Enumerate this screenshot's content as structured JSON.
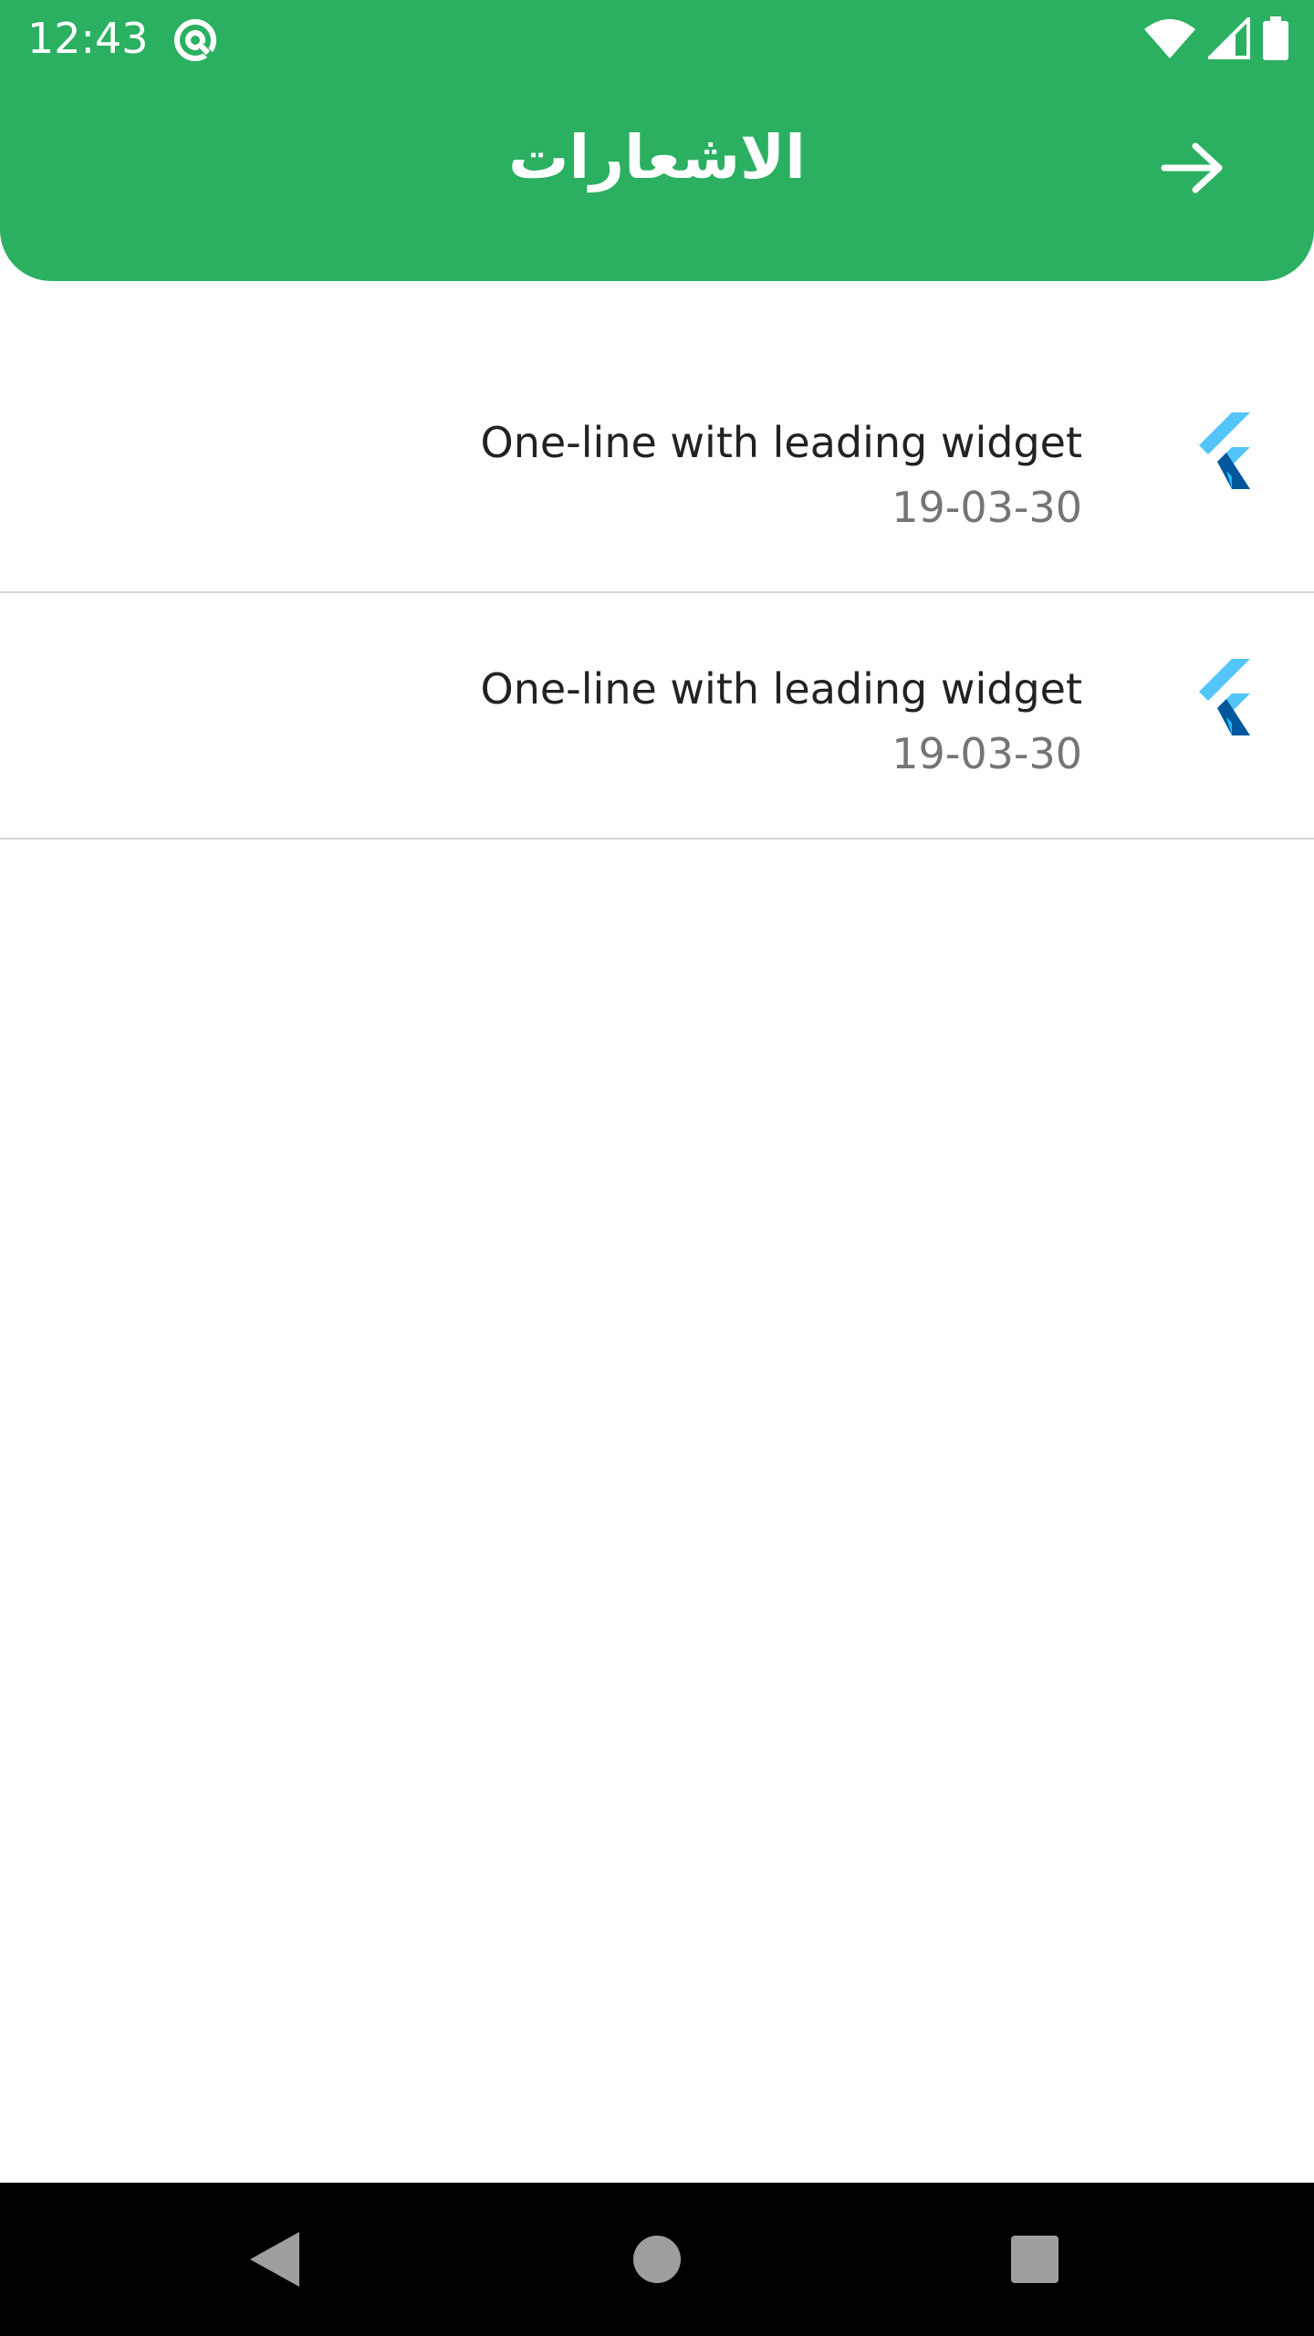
{
  "status_bar": {
    "time": "12:43",
    "icons": [
      "at-sign-icon",
      "wifi-icon",
      "cellular-signal-icon",
      "battery-icon"
    ]
  },
  "app_bar": {
    "title": "الاشعارات",
    "back_icon": "arrow-right-icon",
    "color": "#2bb062"
  },
  "notifications": [
    {
      "title": "One-line with leading widget",
      "date": "19-03-30",
      "icon": "flutter-logo-icon"
    },
    {
      "title": "One-line with leading widget",
      "date": "19-03-30",
      "icon": "flutter-logo-icon"
    }
  ],
  "nav_bar": {
    "buttons": [
      "back-triangle-icon",
      "home-circle-icon",
      "recents-square-icon"
    ]
  }
}
